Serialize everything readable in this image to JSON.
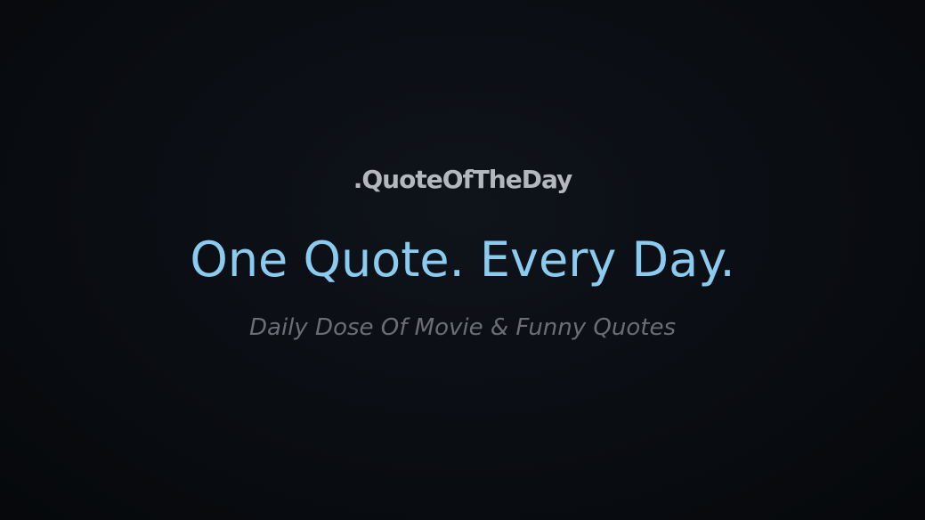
{
  "hero": {
    "brand": ".QuoteOfTheDay",
    "headline": "One Quote. Every Day.",
    "tagline": "Daily Dose Of Movie & Funny Quotes"
  },
  "colors": {
    "background": "#0a0d12",
    "brand": "#b4b7bb",
    "headline": "#8ccbf0",
    "tagline": "#6b6f74"
  }
}
